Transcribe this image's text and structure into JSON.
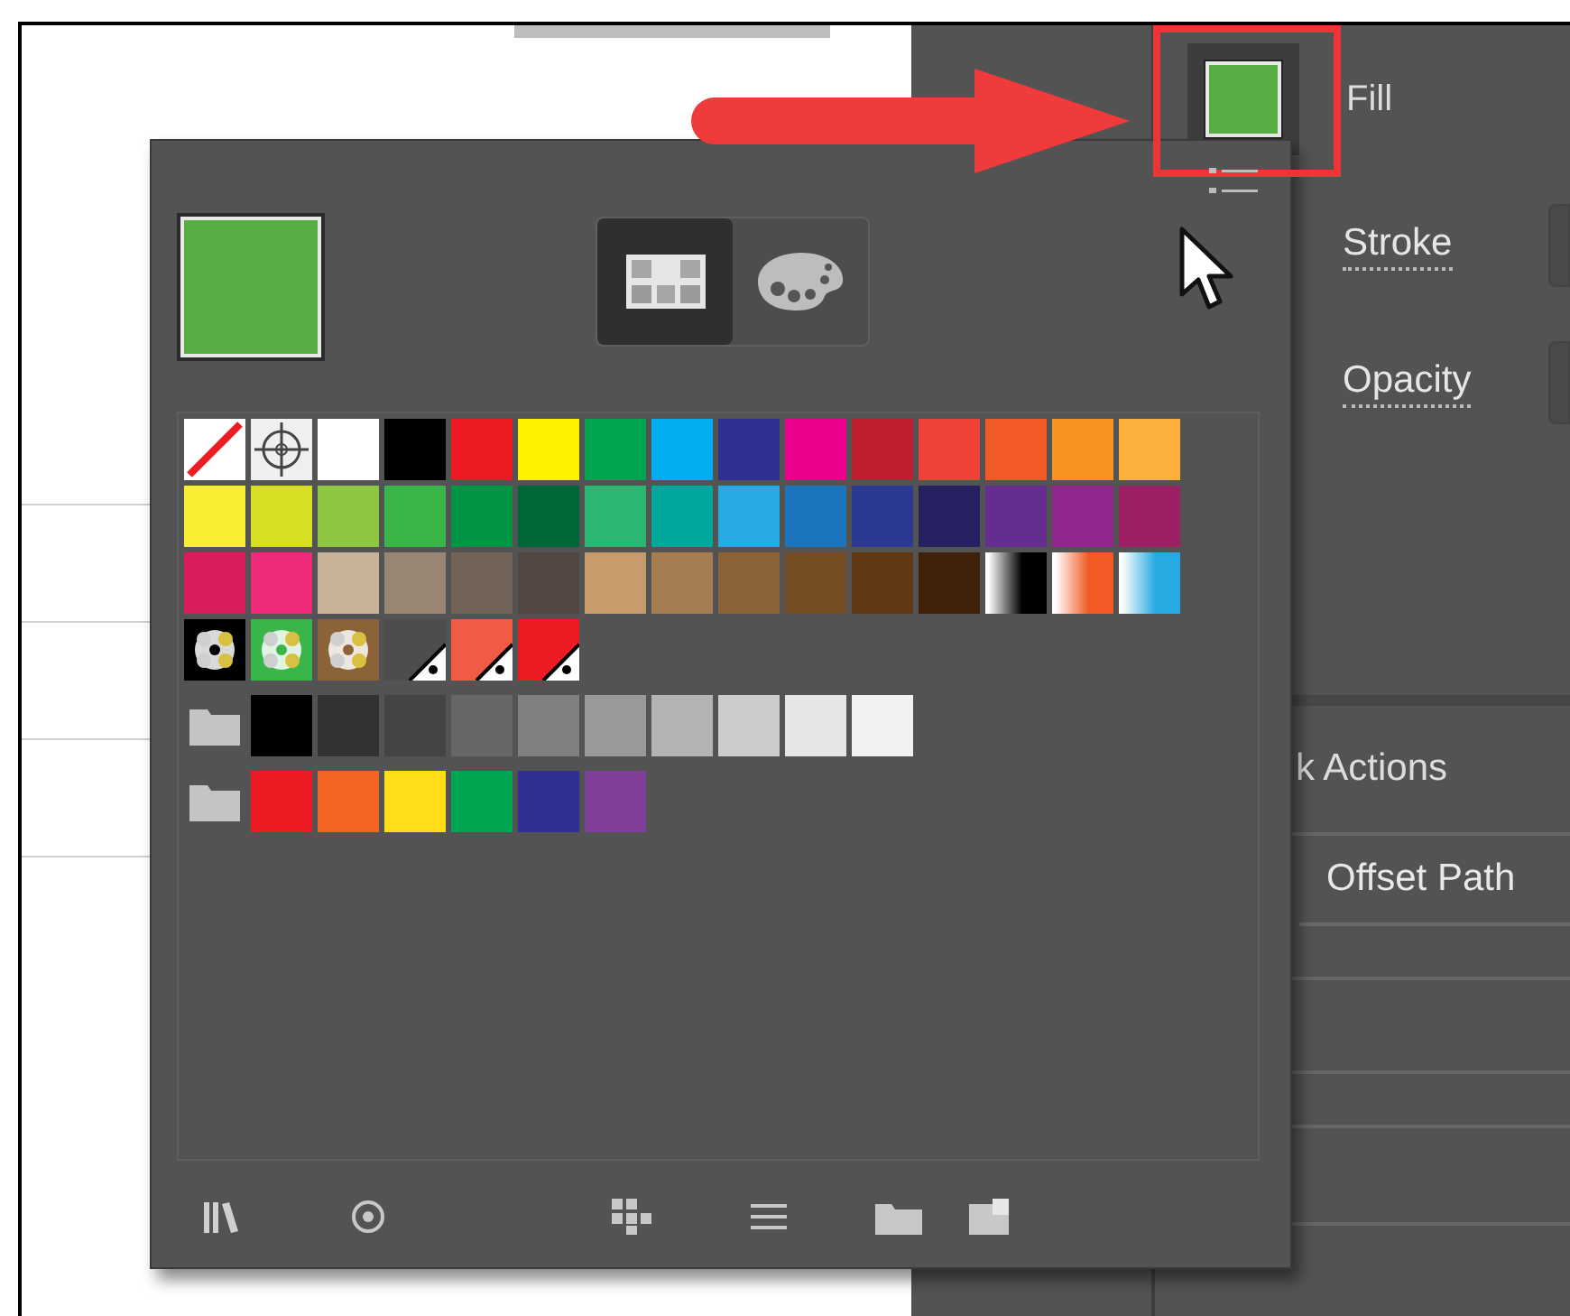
{
  "properties": {
    "fill_label": "Fill",
    "stroke_label": "Stroke",
    "opacity_label": "Opacity",
    "quick_actions_title": "k Actions",
    "offset_path_button": "Offset Path"
  },
  "view_toggle": [
    {
      "kind": "grid",
      "selected": true
    },
    {
      "kind": "palette",
      "selected": false
    }
  ],
  "swatch_rows": [
    {
      "swatches": [
        {
          "kind": "none"
        },
        {
          "kind": "registration"
        },
        {
          "kind": "color",
          "color": "#ffffff"
        },
        {
          "kind": "color",
          "color": "#000000"
        },
        {
          "kind": "color",
          "color": "#ed1c24"
        },
        {
          "kind": "color",
          "color": "#fff200"
        },
        {
          "kind": "color",
          "color": "#00a651"
        },
        {
          "kind": "color",
          "color": "#00aeef"
        },
        {
          "kind": "color",
          "color": "#2e3192"
        },
        {
          "kind": "color",
          "color": "#ec008c"
        },
        {
          "kind": "color",
          "color": "#be1e2d"
        },
        {
          "kind": "color",
          "color": "#ef4136"
        },
        {
          "kind": "color",
          "color": "#f15a24"
        },
        {
          "kind": "color",
          "color": "#f7931e"
        },
        {
          "kind": "color",
          "color": "#fbb03b"
        }
      ]
    },
    {
      "swatches": [
        {
          "kind": "color",
          "color": "#f9ed32"
        },
        {
          "kind": "color",
          "color": "#d7df23"
        },
        {
          "kind": "color",
          "color": "#8dc63f"
        },
        {
          "kind": "color",
          "color": "#39b54a"
        },
        {
          "kind": "color",
          "color": "#009444"
        },
        {
          "kind": "color",
          "color": "#006838"
        },
        {
          "kind": "color",
          "color": "#2bb673"
        },
        {
          "kind": "color",
          "color": "#00a79d"
        },
        {
          "kind": "color",
          "color": "#27aae1"
        },
        {
          "kind": "color",
          "color": "#1c75bc"
        },
        {
          "kind": "color",
          "color": "#2b3990"
        },
        {
          "kind": "color",
          "color": "#262262"
        },
        {
          "kind": "color",
          "color": "#662d91"
        },
        {
          "kind": "color",
          "color": "#92278f"
        },
        {
          "kind": "color",
          "color": "#9e1f63"
        }
      ]
    },
    {
      "swatches": [
        {
          "kind": "color",
          "color": "#da1c5c"
        },
        {
          "kind": "color",
          "color": "#ee2a7b"
        },
        {
          "kind": "color",
          "color": "#c7b299"
        },
        {
          "kind": "color",
          "color": "#998675"
        },
        {
          "kind": "color",
          "color": "#736357"
        },
        {
          "kind": "color",
          "color": "#534741"
        },
        {
          "kind": "color",
          "color": "#c69c6d"
        },
        {
          "kind": "color",
          "color": "#a67c52"
        },
        {
          "kind": "color",
          "color": "#8c6239"
        },
        {
          "kind": "color",
          "color": "#754c24"
        },
        {
          "kind": "color",
          "color": "#603813"
        },
        {
          "kind": "color",
          "color": "#42210b"
        },
        {
          "kind": "gradient",
          "color": "#000000"
        },
        {
          "kind": "gradient",
          "color": "#f15a24"
        },
        {
          "kind": "gradient",
          "color": "#27aae1"
        }
      ]
    },
    {
      "swatches": [
        {
          "kind": "pattern",
          "color": "#000000"
        },
        {
          "kind": "pattern",
          "color": "#39b54a"
        },
        {
          "kind": "pattern",
          "color": "#8c6239"
        },
        {
          "kind": "global",
          "color": "#4d4d4d"
        },
        {
          "kind": "global",
          "color": "#f15a43"
        },
        {
          "kind": "global",
          "color": "#ed1c24"
        }
      ]
    },
    {
      "swatches": [
        {
          "kind": "folder"
        },
        {
          "kind": "color",
          "color": "#000000"
        },
        {
          "kind": "color",
          "color": "#333333"
        },
        {
          "kind": "color",
          "color": "#444444"
        },
        {
          "kind": "color",
          "color": "#666666"
        },
        {
          "kind": "color",
          "color": "#808080"
        },
        {
          "kind": "color",
          "color": "#999999"
        },
        {
          "kind": "color",
          "color": "#b3b3b3"
        },
        {
          "kind": "color",
          "color": "#cccccc"
        },
        {
          "kind": "color",
          "color": "#e6e6e6"
        },
        {
          "kind": "color",
          "color": "#f2f2f2"
        }
      ]
    },
    {
      "swatches": [
        {
          "kind": "folder"
        },
        {
          "kind": "color",
          "color": "#ed1c24"
        },
        {
          "kind": "color",
          "color": "#f26522"
        },
        {
          "kind": "color",
          "color": "#ffde17"
        },
        {
          "kind": "color",
          "color": "#00a651"
        },
        {
          "kind": "color",
          "color": "#2e3192"
        },
        {
          "kind": "color",
          "color": "#7f3f98"
        }
      ]
    }
  ]
}
